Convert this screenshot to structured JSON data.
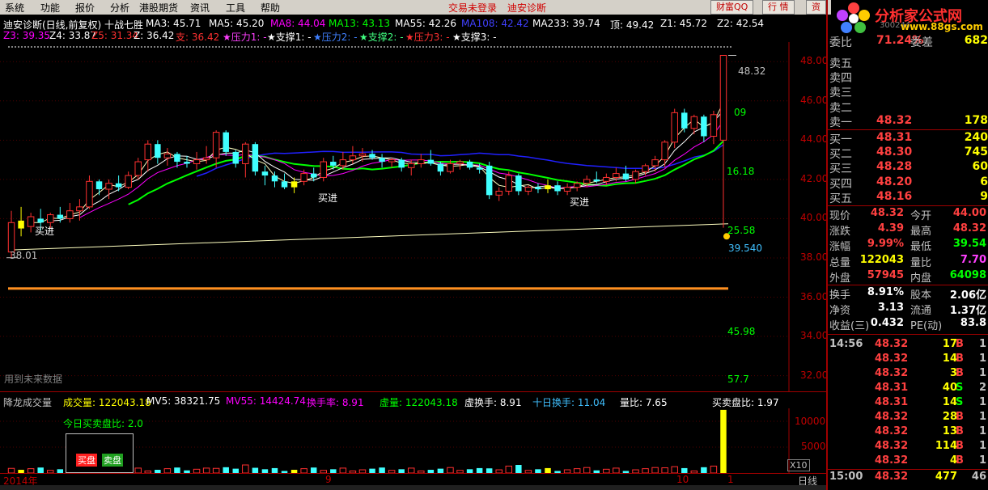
{
  "menu": {
    "items": [
      "系统",
      "功能",
      "报价",
      "分析",
      "港股期货",
      "资讯",
      "工具",
      "帮助"
    ],
    "center_links": [
      "交易未登录",
      "迪安诊断"
    ],
    "buttons": [
      "财富QQ",
      "行 情",
      "资"
    ]
  },
  "logo": {
    "brand": "分析家公式网",
    "url": "www.88gs.com",
    "code": "300244"
  },
  "header": {
    "title": "迪安诊断(日线,前复权) 十战七胜",
    "ma": [
      {
        "label": "MA3: 45.71",
        "color": "#ffffff"
      },
      {
        "label": "MA5: 45.20",
        "color": "#ffffff"
      },
      {
        "label": "MA8: 44.04",
        "color": "#ff00ff"
      },
      {
        "label": "MA13: 43.13",
        "color": "#00ff00"
      },
      {
        "label": "MA55: 42.26",
        "color": "#ffffff"
      },
      {
        "label": "MA108: 42.42",
        "color": "#4040ff"
      },
      {
        "label": "MA233: 39.74",
        "color": "#ffffff"
      },
      {
        "label": "顶: 49.42",
        "color": "#ffffff"
      },
      {
        "label": "Z1: 45.72",
        "color": "#ffffff"
      },
      {
        "label": "Z2: 42.54",
        "color": "#ffffff"
      }
    ],
    "row2": [
      {
        "label": "Z3: 39.35",
        "color": "#ff00ff"
      },
      {
        "label": "Z4: 33.87",
        "color": "#ffffff"
      },
      {
        "label": "Z5: 31.34",
        "color": "#ff3030"
      },
      {
        "label": "Z: 36.42",
        "color": "#ffffff"
      },
      {
        "label": "支: 36.42",
        "color": "#ff3030"
      },
      {
        "label": "★压力1: -",
        "color": "#ff40ff"
      },
      {
        "label": "★支撑1: -",
        "color": "#ffffff"
      },
      {
        "label": "★压力2: -",
        "color": "#4080ff"
      },
      {
        "label": "★支撑2: -",
        "color": "#40ff80"
      },
      {
        "label": "★压力3: -",
        "color": "#ff3030"
      },
      {
        "label": "★支撑3: -",
        "color": "#ffffff"
      }
    ]
  },
  "price_axis": [
    "48.00",
    "46.00",
    "44.00",
    "42.00",
    "40.00",
    "38.00",
    "36.00",
    "34.00",
    "32.00"
  ],
  "chart_labels": {
    "low_marker": "38.01",
    "high_marker": "48.32",
    "buy": "买进",
    "right_vals": [
      "09",
      "16.18",
      "25.58",
      "39.540",
      "45.98",
      "57.7"
    ],
    "future_note": "用到未来数据"
  },
  "volume": {
    "title": "降龙成交量",
    "items": [
      {
        "label": "成交量: 122043.18",
        "color": "#ffff00"
      },
      {
        "label": "MV5: 38321.75",
        "color": "#ffffff"
      },
      {
        "label": "MV55: 14424.74",
        "color": "#ff00ff"
      },
      {
        "label": "换手率: 8.91",
        "color": "#ff00ff"
      },
      {
        "label": "虚量: 122043.18",
        "color": "#00ff00"
      },
      {
        "label": "虚换手: 8.91",
        "color": "#ffffff"
      },
      {
        "label": "十日换手: 11.04",
        "color": "#40c0ff"
      },
      {
        "label": "量比: 7.65",
        "color": "#ffffff"
      },
      {
        "label": "买卖盘比: 1.97",
        "color": "#ffffff"
      }
    ],
    "today_ratio": "今日买卖盘比: 2.0",
    "buy_label": "买盘",
    "sell_label": "卖盘",
    "axis": [
      "10000",
      "5000"
    ],
    "x10": "X10"
  },
  "timeline": {
    "year": "2014年",
    "m9": "9",
    "m10": "10",
    "m1": "1",
    "rightlabel": "日线"
  },
  "quote": {
    "top": [
      {
        "n": "委比",
        "p": "71.24%",
        "l": "委差",
        "v": "682"
      }
    ],
    "sells": [
      {
        "n": "卖五",
        "p": "",
        "v": ""
      },
      {
        "n": "卖四",
        "p": "",
        "v": ""
      },
      {
        "n": "卖三",
        "p": "",
        "v": ""
      },
      {
        "n": "卖二",
        "p": "",
        "v": ""
      },
      {
        "n": "卖一",
        "p": "48.32",
        "v": "178"
      }
    ],
    "buys": [
      {
        "n": "买一",
        "p": "48.31",
        "v": "240"
      },
      {
        "n": "买二",
        "p": "48.30",
        "v": "745"
      },
      {
        "n": "买三",
        "p": "48.28",
        "v": "60"
      },
      {
        "n": "买四",
        "p": "48.20",
        "v": "6"
      },
      {
        "n": "买五",
        "p": "48.16",
        "v": "9"
      }
    ],
    "stats": [
      {
        "a": "现价",
        "b": "48.32",
        "c": "今开",
        "d": "44.00",
        "bc": "#ff4040",
        "dc": "#ff4040"
      },
      {
        "a": "涨跌",
        "b": "4.39",
        "c": "最高",
        "d": "48.32",
        "bc": "#ff4040",
        "dc": "#ff4040"
      },
      {
        "a": "涨幅",
        "b": "9.99%",
        "c": "最低",
        "d": "39.54",
        "bc": "#ff4040",
        "dc": "#00ff00"
      },
      {
        "a": "总量",
        "b": "122043",
        "c": "量比",
        "d": "7.70",
        "bc": "#ffff00",
        "dc": "#ff40ff"
      },
      {
        "a": "外盘",
        "b": "57945",
        "c": "内盘",
        "d": "64098",
        "bc": "#ff4040",
        "dc": "#00ff00"
      },
      {
        "a": "换手",
        "b": "8.91%",
        "c": "股本",
        "d": "2.06亿",
        "bc": "#ffffff",
        "dc": "#ffffff"
      },
      {
        "a": "净资",
        "b": "3.13",
        "c": "流通",
        "d": "1.37亿",
        "bc": "#ffffff",
        "dc": "#ffffff"
      },
      {
        "a": "收益(三)",
        "b": "0.432",
        "c": "PE(动)",
        "d": "83.8",
        "bc": "#ffffff",
        "dc": "#ffffff"
      }
    ],
    "ticks": [
      {
        "t": "14:56",
        "p": "48.32",
        "v": "17",
        "s": "B",
        "x": "1"
      },
      {
        "t": "",
        "p": "48.32",
        "v": "14",
        "s": "B",
        "x": "1"
      },
      {
        "t": "",
        "p": "48.32",
        "v": "3",
        "s": "B",
        "x": "1"
      },
      {
        "t": "",
        "p": "48.31",
        "v": "40",
        "s": "S",
        "x": "2"
      },
      {
        "t": "",
        "p": "48.31",
        "v": "14",
        "s": "S",
        "x": "1"
      },
      {
        "t": "",
        "p": "48.32",
        "v": "28",
        "s": "B",
        "x": "1"
      },
      {
        "t": "",
        "p": "48.32",
        "v": "13",
        "s": "B",
        "x": "1"
      },
      {
        "t": "",
        "p": "48.32",
        "v": "114",
        "s": "B",
        "x": "1"
      },
      {
        "t": "",
        "p": "48.32",
        "v": "4",
        "s": "B",
        "x": "1"
      },
      {
        "t": "15:00",
        "p": "48.32",
        "v": "477",
        "s": "",
        "x": "46"
      }
    ]
  },
  "colors": {
    "up": "#ff3030",
    "down": "#40ffff",
    "buy_candle": "#ffff00",
    "grid": "#600000"
  },
  "candles": [
    {
      "o": 38.3,
      "h": 40.4,
      "l": 38.01,
      "c": 39.8,
      "b": 0
    },
    {
      "o": 39.9,
      "h": 40.6,
      "l": 39.1,
      "c": 39.5,
      "b": 1
    },
    {
      "o": 39.6,
      "h": 40.3,
      "l": 39.3,
      "c": 40.1,
      "b": 0
    },
    {
      "o": 40.0,
      "h": 40.5,
      "l": 39.4,
      "c": 39.8,
      "b": 0
    },
    {
      "o": 39.8,
      "h": 40.3,
      "l": 39.5,
      "c": 40.2,
      "b": 0
    },
    {
      "o": 40.2,
      "h": 40.6,
      "l": 39.8,
      "c": 40.0,
      "b": 0
    },
    {
      "o": 40.0,
      "h": 40.8,
      "l": 39.8,
      "c": 40.4,
      "b": 0
    },
    {
      "o": 40.4,
      "h": 41.0,
      "l": 39.9,
      "c": 40.6,
      "b": 0
    },
    {
      "o": 40.6,
      "h": 42.2,
      "l": 40.5,
      "c": 41.9,
      "b": 0
    },
    {
      "o": 41.9,
      "h": 42.0,
      "l": 41.2,
      "c": 41.5,
      "b": 0
    },
    {
      "o": 41.5,
      "h": 42.0,
      "l": 41.0,
      "c": 41.8,
      "b": 0
    },
    {
      "o": 41.8,
      "h": 42.2,
      "l": 41.4,
      "c": 41.6,
      "b": 0
    },
    {
      "o": 41.6,
      "h": 42.4,
      "l": 41.5,
      "c": 42.2,
      "b": 0
    },
    {
      "o": 42.2,
      "h": 43.1,
      "l": 42.0,
      "c": 42.9,
      "b": 0
    },
    {
      "o": 43.0,
      "h": 44.0,
      "l": 42.4,
      "c": 43.8,
      "b": 0
    },
    {
      "o": 43.8,
      "h": 44.0,
      "l": 42.8,
      "c": 43.1,
      "b": 0
    },
    {
      "o": 43.1,
      "h": 43.6,
      "l": 42.7,
      "c": 43.3,
      "b": 0
    },
    {
      "o": 43.3,
      "h": 43.4,
      "l": 42.6,
      "c": 42.9,
      "b": 0
    },
    {
      "o": 42.9,
      "h": 43.2,
      "l": 42.6,
      "c": 42.8,
      "b": 0
    },
    {
      "o": 42.8,
      "h": 43.4,
      "l": 42.5,
      "c": 43.0,
      "b": 0
    },
    {
      "o": 43.0,
      "h": 43.7,
      "l": 42.8,
      "c": 43.1,
      "b": 0
    },
    {
      "o": 43.1,
      "h": 44.5,
      "l": 42.6,
      "c": 44.4,
      "b": 0
    },
    {
      "o": 44.4,
      "h": 44.5,
      "l": 43.2,
      "c": 43.4,
      "b": 0
    },
    {
      "o": 43.4,
      "h": 43.5,
      "l": 42.6,
      "c": 42.8,
      "b": 0
    },
    {
      "o": 42.8,
      "h": 43.9,
      "l": 42.1,
      "c": 43.8,
      "b": 0
    },
    {
      "o": 43.8,
      "h": 43.9,
      "l": 42.2,
      "c": 42.4,
      "b": 0
    },
    {
      "o": 42.4,
      "h": 42.7,
      "l": 41.7,
      "c": 42.2,
      "b": 0
    },
    {
      "o": 42.2,
      "h": 42.4,
      "l": 41.6,
      "c": 41.9,
      "b": 0
    },
    {
      "o": 41.9,
      "h": 42.3,
      "l": 41.5,
      "c": 41.6,
      "b": 0
    },
    {
      "o": 41.6,
      "h": 42.1,
      "l": 41.3,
      "c": 41.9,
      "b": 1
    },
    {
      "o": 41.9,
      "h": 42.5,
      "l": 41.7,
      "c": 42.3,
      "b": 0
    },
    {
      "o": 42.3,
      "h": 42.6,
      "l": 41.9,
      "c": 42.1,
      "b": 0
    },
    {
      "o": 42.1,
      "h": 43.1,
      "l": 41.9,
      "c": 42.9,
      "b": 0
    },
    {
      "o": 42.9,
      "h": 43.2,
      "l": 42.5,
      "c": 42.7,
      "b": 0
    },
    {
      "o": 42.7,
      "h": 43.4,
      "l": 42.5,
      "c": 43.0,
      "b": 0
    },
    {
      "o": 43.0,
      "h": 43.7,
      "l": 42.8,
      "c": 43.2,
      "b": 0
    },
    {
      "o": 43.2,
      "h": 43.6,
      "l": 42.9,
      "c": 43.3,
      "b": 0
    },
    {
      "o": 43.3,
      "h": 43.5,
      "l": 43.0,
      "c": 43.1,
      "b": 0
    },
    {
      "o": 43.1,
      "h": 43.3,
      "l": 42.6,
      "c": 42.9,
      "b": 0
    },
    {
      "o": 42.9,
      "h": 43.1,
      "l": 42.6,
      "c": 43.0,
      "b": 0
    },
    {
      "o": 43.0,
      "h": 43.1,
      "l": 42.4,
      "c": 42.6,
      "b": 0
    },
    {
      "o": 42.6,
      "h": 43.0,
      "l": 42.2,
      "c": 42.8,
      "b": 0
    },
    {
      "o": 42.8,
      "h": 43.3,
      "l": 42.6,
      "c": 43.0,
      "b": 0
    },
    {
      "o": 43.0,
      "h": 43.5,
      "l": 42.7,
      "c": 42.8,
      "b": 0
    },
    {
      "o": 42.8,
      "h": 42.9,
      "l": 42.2,
      "c": 42.4,
      "b": 0
    },
    {
      "o": 42.4,
      "h": 43.0,
      "l": 42.3,
      "c": 42.8,
      "b": 0
    },
    {
      "o": 42.8,
      "h": 43.0,
      "l": 42.5,
      "c": 42.9,
      "b": 0
    },
    {
      "o": 42.9,
      "h": 43.0,
      "l": 42.5,
      "c": 42.6,
      "b": 0
    },
    {
      "o": 42.6,
      "h": 42.8,
      "l": 42.3,
      "c": 42.5,
      "b": 0
    },
    {
      "o": 42.7,
      "h": 42.9,
      "l": 41.0,
      "c": 41.2,
      "b": 0
    },
    {
      "o": 41.2,
      "h": 41.6,
      "l": 40.9,
      "c": 41.4,
      "b": 0
    },
    {
      "o": 41.4,
      "h": 42.4,
      "l": 41.2,
      "c": 42.2,
      "b": 0
    },
    {
      "o": 42.2,
      "h": 42.3,
      "l": 41.2,
      "c": 41.4,
      "b": 0
    },
    {
      "o": 41.4,
      "h": 41.7,
      "l": 41.2,
      "c": 41.6,
      "b": 0
    },
    {
      "o": 41.6,
      "h": 41.8,
      "l": 41.3,
      "c": 41.5,
      "b": 0
    },
    {
      "o": 41.5,
      "h": 42.0,
      "l": 41.3,
      "c": 41.7,
      "b": 1
    },
    {
      "o": 41.7,
      "h": 41.9,
      "l": 41.2,
      "c": 41.4,
      "b": 0
    },
    {
      "o": 41.4,
      "h": 41.8,
      "l": 41.2,
      "c": 41.6,
      "b": 0
    },
    {
      "o": 41.6,
      "h": 41.9,
      "l": 41.4,
      "c": 41.8,
      "b": 0
    },
    {
      "o": 41.8,
      "h": 42.2,
      "l": 41.6,
      "c": 42.0,
      "b": 0
    },
    {
      "o": 42.0,
      "h": 42.4,
      "l": 41.8,
      "c": 41.9,
      "b": 0
    },
    {
      "o": 41.9,
      "h": 42.3,
      "l": 41.7,
      "c": 42.1,
      "b": 0
    },
    {
      "o": 42.1,
      "h": 42.6,
      "l": 41.9,
      "c": 42.3,
      "b": 0
    },
    {
      "o": 42.3,
      "h": 42.7,
      "l": 41.9,
      "c": 42.0,
      "b": 0
    },
    {
      "o": 42.0,
      "h": 42.5,
      "l": 41.8,
      "c": 42.4,
      "b": 0
    },
    {
      "o": 42.4,
      "h": 42.8,
      "l": 42.2,
      "c": 42.7,
      "b": 0
    },
    {
      "o": 42.7,
      "h": 43.2,
      "l": 42.4,
      "c": 43.0,
      "b": 0
    },
    {
      "o": 43.0,
      "h": 44.0,
      "l": 42.6,
      "c": 43.9,
      "b": 0
    },
    {
      "o": 43.9,
      "h": 45.6,
      "l": 43.6,
      "c": 45.4,
      "b": 0
    },
    {
      "o": 45.4,
      "h": 45.6,
      "l": 44.4,
      "c": 44.6,
      "b": 0
    },
    {
      "o": 44.6,
      "h": 45.3,
      "l": 44.3,
      "c": 45.2,
      "b": 0
    },
    {
      "o": 45.2,
      "h": 45.3,
      "l": 43.9,
      "c": 44.2,
      "b": 0
    },
    {
      "o": 44.2,
      "h": 45.5,
      "l": 43.8,
      "c": 45.3,
      "b": 0
    },
    {
      "o": 44.0,
      "h": 48.32,
      "l": 39.54,
      "c": 48.32,
      "b": 0
    }
  ]
}
